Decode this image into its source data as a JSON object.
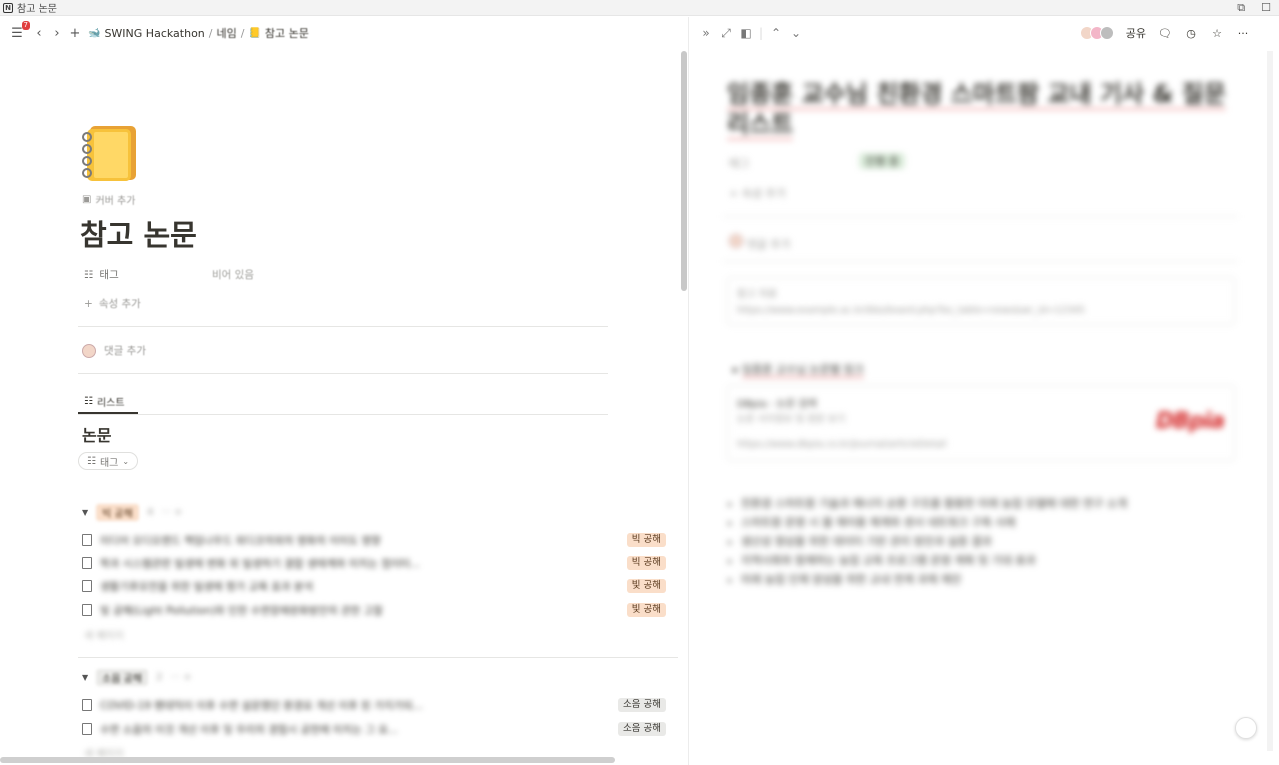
{
  "window": {
    "title": "참고 논문"
  },
  "topbar": {
    "notification_count": "7",
    "breadcrumb": [
      "SWING Hackathon",
      "/",
      "네임",
      "/",
      "참고 논문"
    ]
  },
  "page": {
    "add_cover": "커버 추가",
    "title": "참고 논문",
    "property": {
      "name": "태그",
      "value": "비어 있음"
    },
    "add_property": "속성 추가",
    "add_comment": "댓글 추가",
    "view_tab": "리스트",
    "database_title": "논문",
    "filter_chip": "태그"
  },
  "groups": [
    {
      "tag": "빅 공해",
      "count": "4",
      "rows": [
        {
          "title": "미디어 오디오랜드 책임나우드 외디코의외의 영화의 이미도 영향",
          "tag": "빅 공해"
        },
        {
          "title": "학과 시스템관련 빌생에 변화 외 빌생하기 결합 생태계와 미치는 점이터...",
          "tag": "빅 공해"
        },
        {
          "title": "생활기후모전을 위한 빌생에 평가 교육 효과 분석",
          "tag": "빛 공해"
        },
        {
          "title": "빛 공해(Light Pollution)와 인한 수면장애완화방안의 관한 고찰",
          "tag": "빛 공해"
        }
      ],
      "new_label": "새 페이지"
    },
    {
      "tag": "소음 공해",
      "count": "2",
      "rows": [
        {
          "title": "COVID-19 팬데믹이 이후 수면 설문했던 환경요 개선 이후 된 가지가되...",
          "tag": "소음 공해"
        },
        {
          "title": "수면 소음의 이것 개선 이후 및 우리의 경험시 공헌에 미치는 그 요...",
          "tag": "소음 공해"
        }
      ],
      "new_label": "새 페이지"
    }
  ],
  "right_pane": {
    "share_label": "공유",
    "title": "임종훈 교수님 친환경 스마트팜 교내 기사 & 질문 리스트",
    "property_name": "태그",
    "property_value": "진행 중",
    "add_property": "속성 추가",
    "add_comment": "댓글 추가",
    "callout_label": "참고 자료",
    "callout_url": "https://www.example.ac.kr/bbs/board.php?bo_table=news&wr_id=12345",
    "toggle_heading": "임종훈 교수님 논문별 링크",
    "bookmark_title": "DBpia - 논문 검색",
    "bookmark_desc": "논문 서지정보 및 원문 보기",
    "bookmark_url": "https://www.dbpia.co.kr/Journal/articleDetail",
    "bookmark_brand": "DBpia",
    "bullets": [
      "친환경 스마트팜 기술과 에너지 순환 구조를 활용한 미래 농업 모델에 대한 연구 소개",
      "스마트팜 운영 시 물 재이용 체계와 센서 네트워크 구축 사례",
      "생산성 향상을 위한 데이터 기반 관리 방안과 실증 결과",
      "지역사회와 함께하는 농업 교육 프로그램 운영 계획 및 기대 효과",
      "미래 농업 인재 양성을 위한 교내 연계 과제 제안"
    ]
  },
  "colors": {
    "tag_orange_bg": "#fadec9",
    "tag_gray_bg": "#e9e9e7",
    "badge_red": "#e03e3e",
    "brand_red": "#d42a2a"
  }
}
